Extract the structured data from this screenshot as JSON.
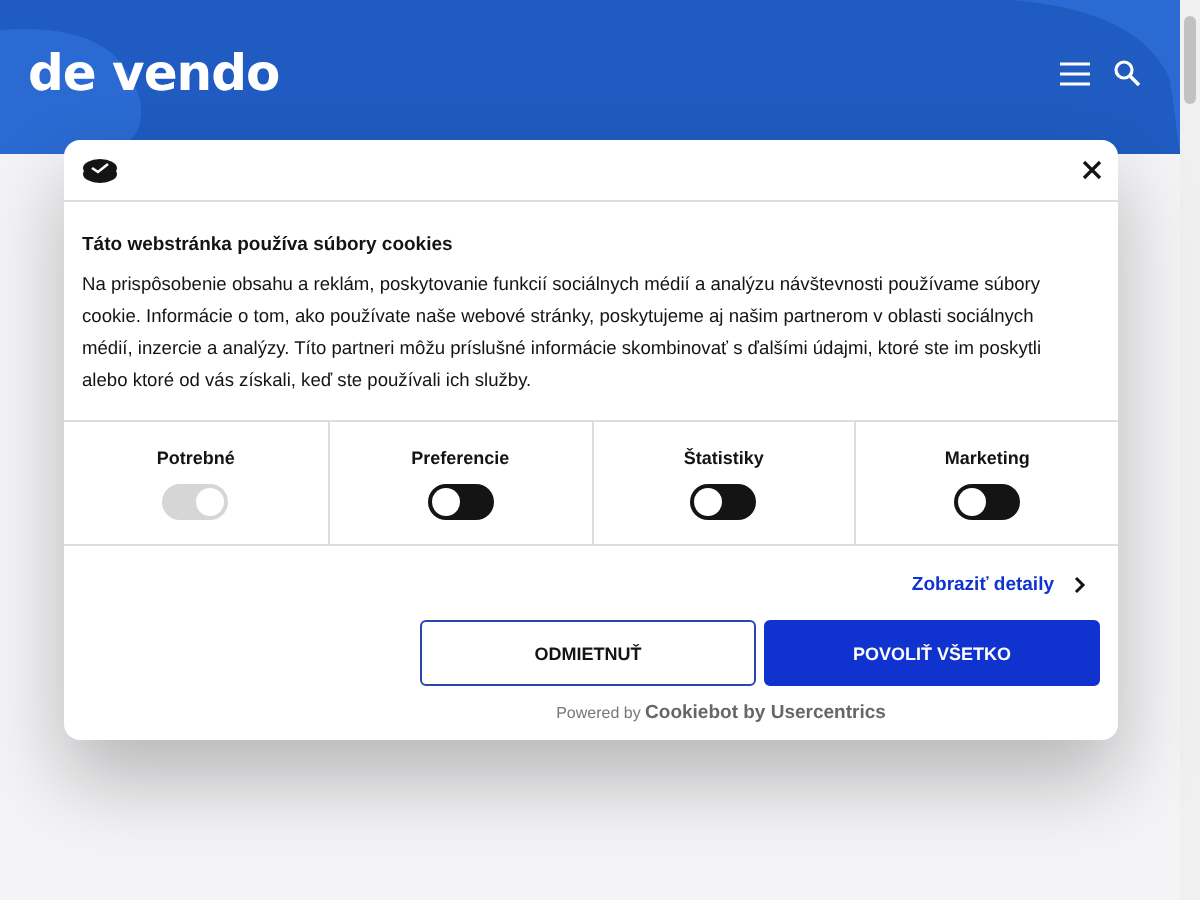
{
  "header": {
    "logo": "de vendo"
  },
  "dialog": {
    "title": "Táto webstránka používa súbory cookies",
    "text": "Na prispôsobenie obsahu a reklám, poskytovanie funkcií sociálnych médií a analýzu návštevnosti používame súbory cookie. Informácie o tom, ako používate naše webové stránky, poskytujeme aj našim partnerom v oblasti sociálnych médií, inzercie a analýzy. Títo partneri môžu príslušné informácie skombinovať s ďalšími údajmi, ktoré ste im poskytli alebo ktoré od vás získali, keď ste používali ich služby.",
    "categories": [
      {
        "label": "Potrebné",
        "on": true,
        "disabled": true
      },
      {
        "label": "Preferencie",
        "on": false,
        "disabled": false
      },
      {
        "label": "Štatistiky",
        "on": false,
        "disabled": false
      },
      {
        "label": "Marketing",
        "on": false,
        "disabled": false
      }
    ],
    "details_link": "Zobraziť detaily",
    "buttons": [
      {
        "label": "ODMIETNUŤ",
        "kind": "outline"
      },
      {
        "label": "POVOLIŤ VŠETKO",
        "kind": "primary"
      }
    ],
    "powered_by": "Powered by **Cookiebot by Usercentrics**"
  }
}
